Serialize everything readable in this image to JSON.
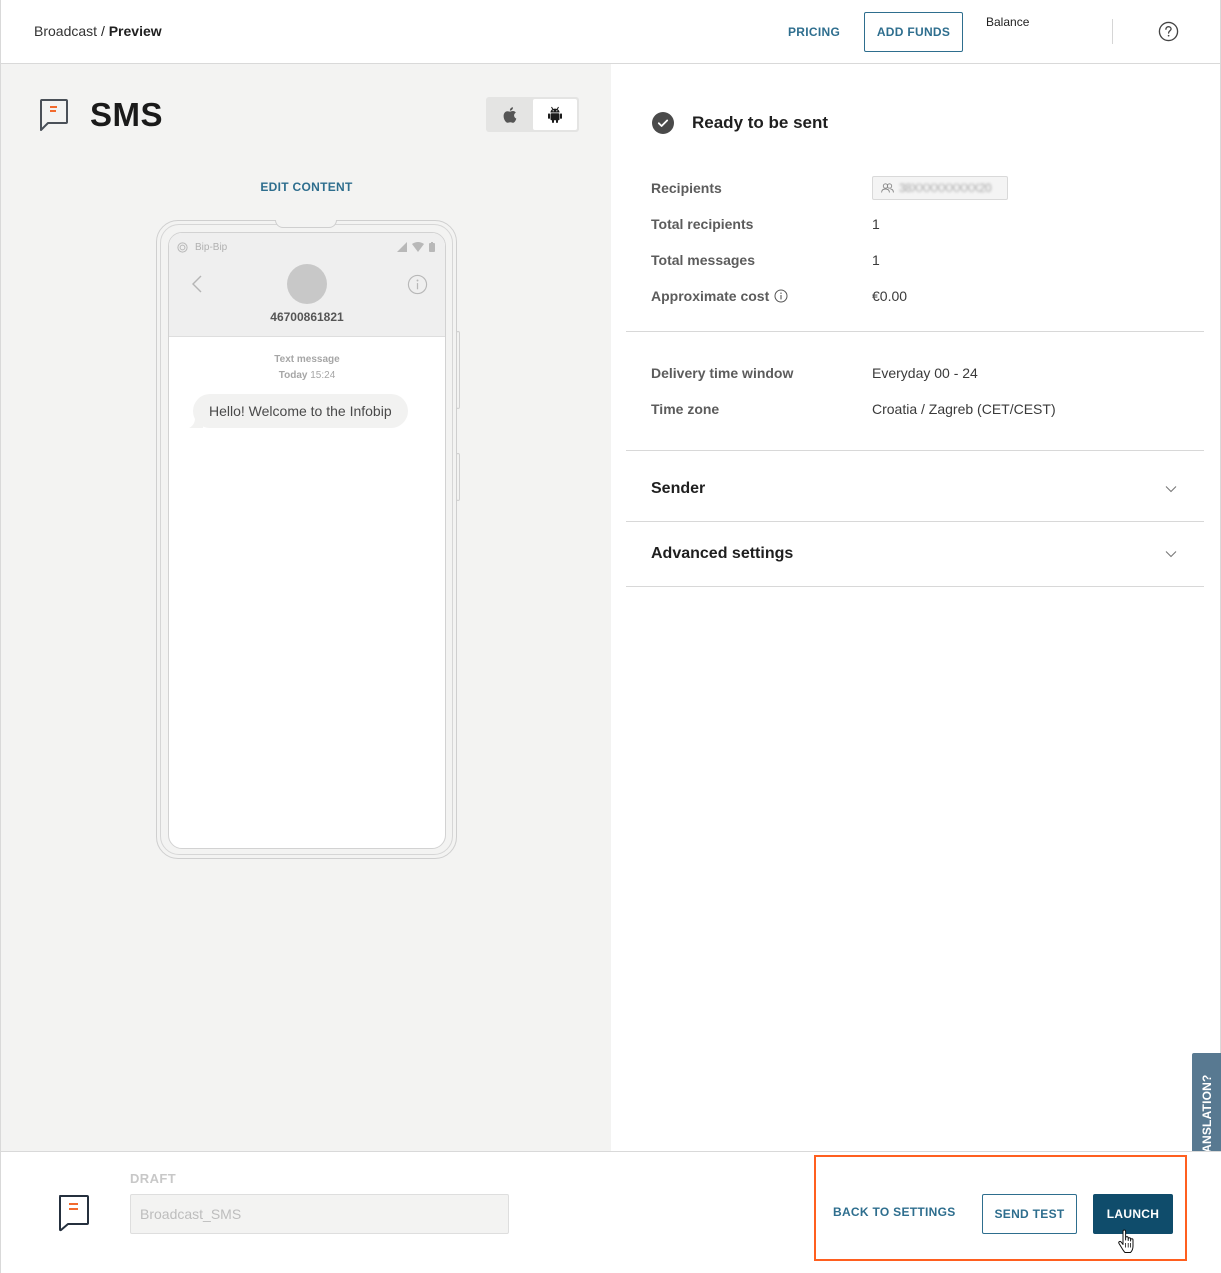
{
  "header": {
    "breadcrumb": {
      "parent": "Broadcast",
      "separator": "/",
      "current": "Preview"
    },
    "pricing_label": "PRICING",
    "add_funds_label": "ADD FUNDS",
    "balance_label": "Balance",
    "help_icon": "question-circle-icon"
  },
  "preview": {
    "channel_title": "SMS",
    "channel_icon": "sms-bubble-icon",
    "os_options": [
      {
        "name": "iOS",
        "icon": "apple-icon",
        "active": false
      },
      {
        "name": "Android",
        "icon": "android-icon",
        "active": true
      }
    ],
    "edit_content_label": "EDIT CONTENT",
    "phone": {
      "carrier": "Bip-Bip",
      "contact_number": "46700861821",
      "message_type": "Text message",
      "message_day": "Today",
      "message_time": "15:24",
      "message_text": "Hello! Welcome to the Infobip"
    }
  },
  "summary": {
    "status_text": "Ready to be sent",
    "status_icon": "check-circle-icon",
    "rows": [
      {
        "label": "Recipients",
        "value": "38XXXXXXXXX20",
        "type": "chip"
      },
      {
        "label": "Total recipients",
        "value": "1"
      },
      {
        "label": "Total messages",
        "value": "1"
      },
      {
        "label": "Approximate cost",
        "value": "€0.00",
        "has_info": true
      }
    ],
    "delivery_rows": [
      {
        "label": "Delivery time window",
        "value": "Everyday 00 - 24"
      },
      {
        "label": "Time zone",
        "value": "Croatia / Zagreb (CET/CEST)"
      }
    ],
    "accordions": [
      {
        "title": "Sender",
        "expanded": false
      },
      {
        "title": "Advanced settings",
        "expanded": false
      }
    ]
  },
  "feedback_tab_label": "LOST IN TRANSLATION?",
  "footer": {
    "draft_label": "DRAFT",
    "name_value": "Broadcast_SMS",
    "back_to_settings_label": "BACK TO SETTINGS",
    "send_test_label": "SEND TEST",
    "launch_label": "LAUNCH"
  },
  "colors": {
    "accent": "#2e6e8e",
    "primary_button": "#0f4c6b",
    "highlight": "#ff5f1f",
    "sms_icon_accent": "#f26a2e",
    "feedback_tab": "#587991"
  }
}
